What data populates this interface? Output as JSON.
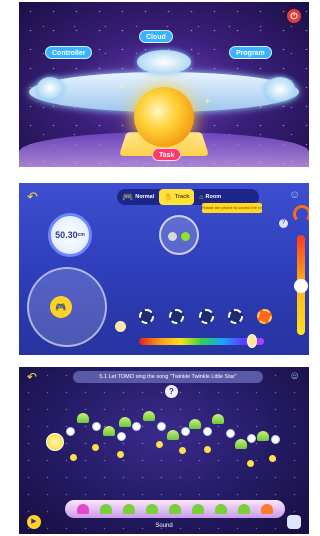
{
  "home": {
    "labels": {
      "cloud": "Cloud",
      "controller": "Controller",
      "program": "Program",
      "task": "Task"
    },
    "colors": {
      "cloud": "#36b4ff",
      "controller": "#36b4ff",
      "program": "#36b4ff",
      "task": "#ff3a6a"
    },
    "power_icon": "power-icon"
  },
  "control": {
    "tabs": [
      {
        "label": "Normal",
        "icon": "gamepad-icon"
      },
      {
        "label": "Track",
        "icon": "hand-icon"
      },
      {
        "label": "Room",
        "icon": "home-icon"
      }
    ],
    "active_tab": "Track",
    "tooltip": "Rotate the phone to control the robot",
    "speed_value": "50.30",
    "speed_unit": "cm",
    "light_colors": [
      "#d9d9d9",
      "#8fe32a"
    ],
    "mode_buttons": 5,
    "accent": "#ffe33a"
  },
  "task": {
    "banner": "5.1   Let TOMO sing the song \"Twinkle Twinkle Little Star\"",
    "help": "?",
    "sound_label": "Sound",
    "tray_colors": [
      "#e04ac8",
      "#7ad03a",
      "#7ad03a",
      "#7ad03a",
      "#7ad03a",
      "#7ad03a",
      "#7ad03a",
      "#7ad03a",
      "#ff7a2a"
    ]
  }
}
